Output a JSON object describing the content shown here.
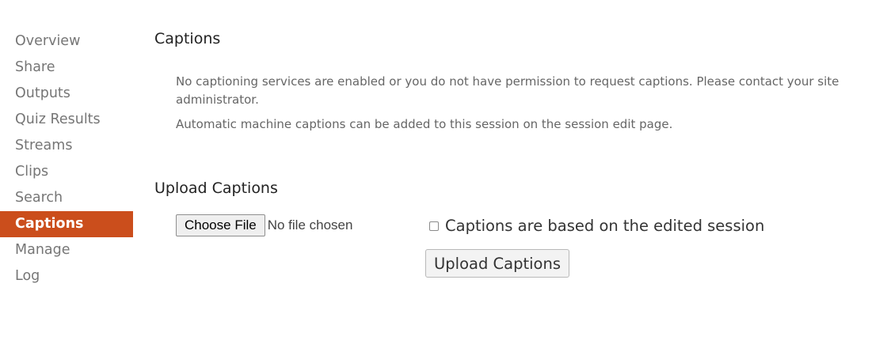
{
  "sidebar": {
    "items": [
      {
        "label": "Overview"
      },
      {
        "label": "Share"
      },
      {
        "label": "Outputs"
      },
      {
        "label": "Quiz Results"
      },
      {
        "label": "Streams"
      },
      {
        "label": "Clips"
      },
      {
        "label": "Search"
      },
      {
        "label": "Captions",
        "active": true
      },
      {
        "label": "Manage"
      },
      {
        "label": "Log"
      }
    ],
    "active_color": "#cb4e1c"
  },
  "main": {
    "captions_title": "Captions",
    "info_line1": "No captioning services are enabled or you do not have permission to request captions. Please contact your site administrator.",
    "info_line2": "Automatic machine captions can be added to this session on the session edit page.",
    "upload_title": "Upload Captions",
    "choose_file_label": "Choose File",
    "file_status": "No file chosen",
    "checkbox_label": "Captions are based on the edited session",
    "checkbox_checked": false,
    "upload_button_label": "Upload Captions"
  }
}
